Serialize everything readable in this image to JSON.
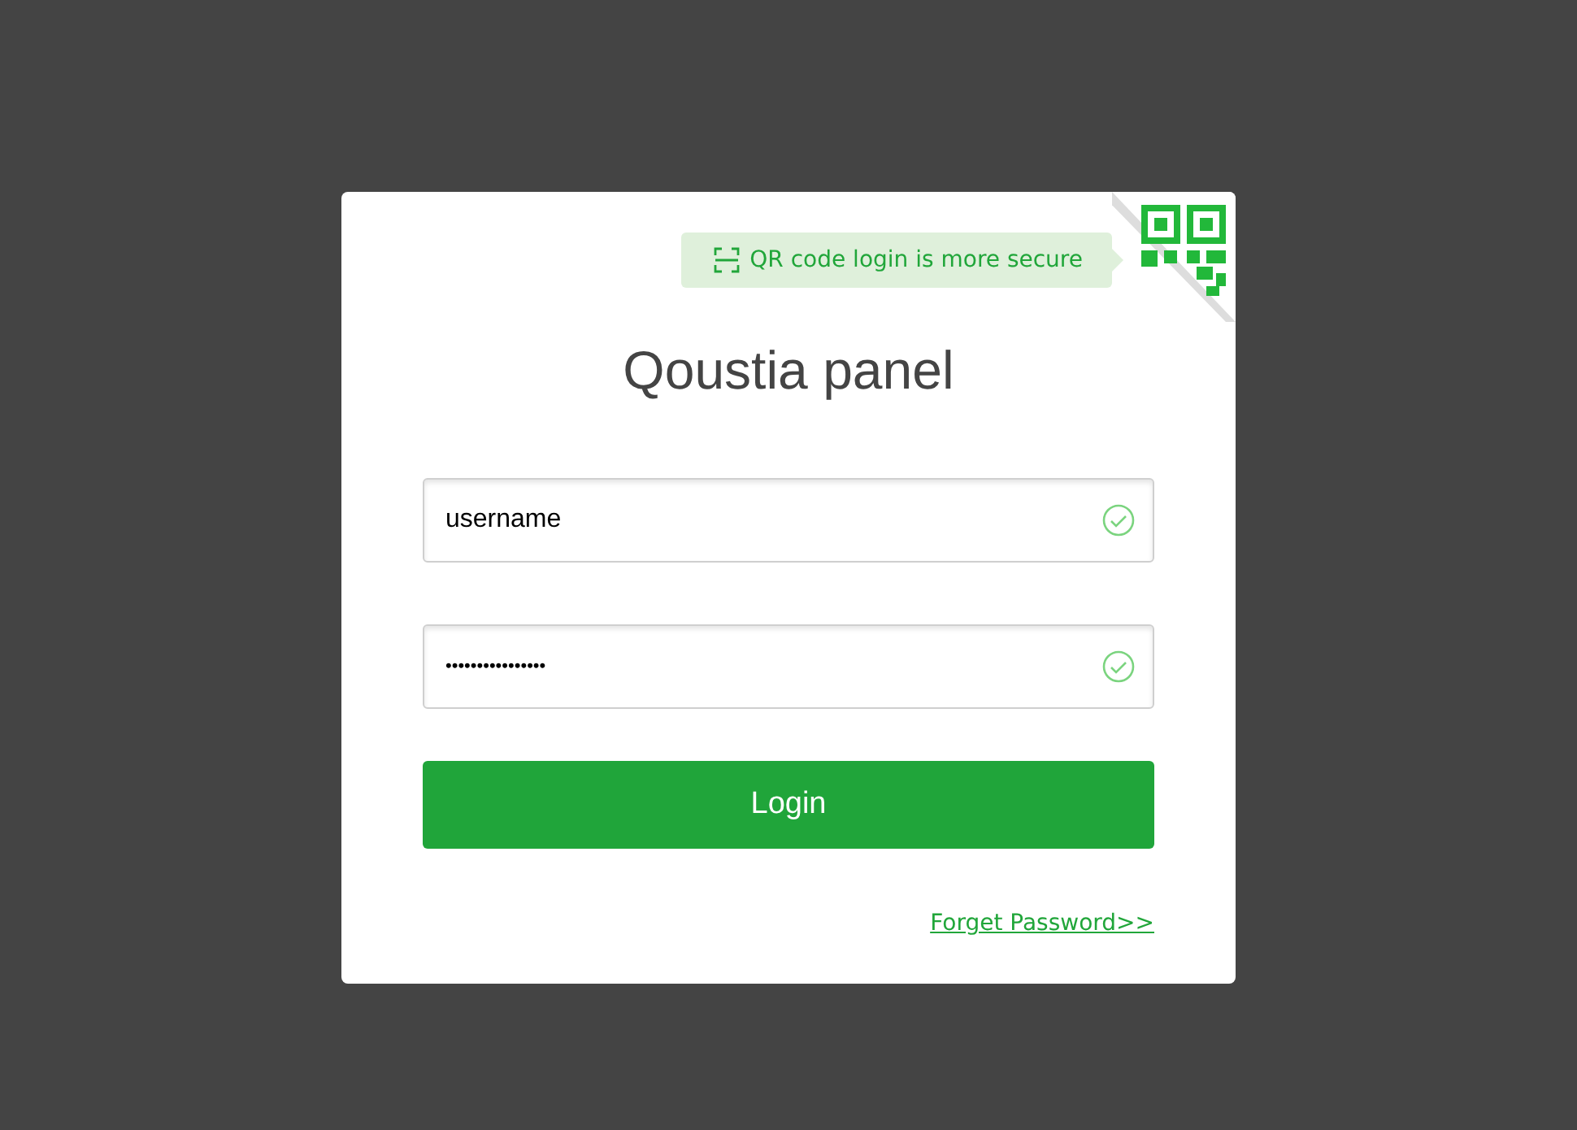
{
  "qr_tip": {
    "text": "QR code login is more secure"
  },
  "title": "Qoustia panel",
  "fields": [
    {
      "kind": "text",
      "value": "username",
      "valid": true
    },
    {
      "kind": "password",
      "value": "••••••••••••••••",
      "valid": true
    }
  ],
  "login_button": "Login",
  "forgot_link": "Forget Password>>"
}
